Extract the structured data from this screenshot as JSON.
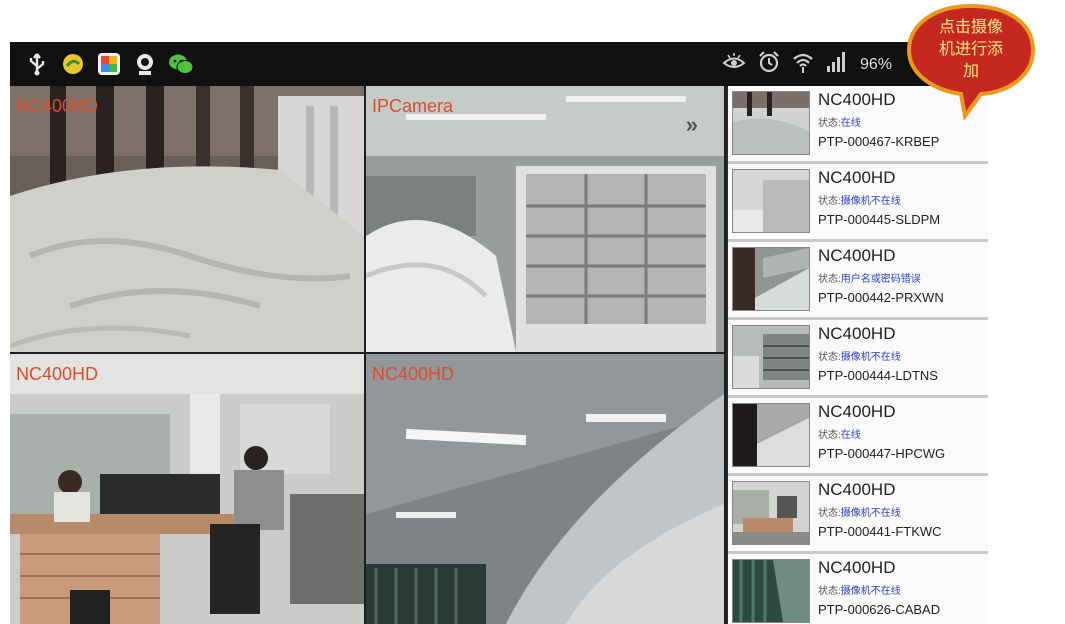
{
  "status_bar": {
    "battery_text": "96%",
    "left_icons": [
      "usb-icon",
      "bean-icon",
      "gallery-icon",
      "camera-app-icon",
      "wechat-icon"
    ],
    "right_icons": [
      "eye-icon",
      "alarm-clock-icon",
      "wifi-icon",
      "signal-icon"
    ]
  },
  "grid": {
    "tiles": [
      {
        "label": "NC400HD"
      },
      {
        "label": "IPCamera"
      },
      {
        "label": "NC400HD"
      },
      {
        "label": "NC400HD"
      }
    ]
  },
  "device_list": {
    "status_label": "状态:",
    "items": [
      {
        "name": "NC400HD",
        "status": "在线",
        "id": "PTP-000467-KRBEP"
      },
      {
        "name": "NC400HD",
        "status": "摄像机不在线",
        "id": "PTP-000445-SLDPM"
      },
      {
        "name": "NC400HD",
        "status": "用户名或密码错误",
        "id": "PTP-000442-PRXWN"
      },
      {
        "name": "NC400HD",
        "status": "摄像机不在线",
        "id": "PTP-000444-LDTNS"
      },
      {
        "name": "NC400HD",
        "status": "在线",
        "id": "PTP-000447-HPCWG"
      },
      {
        "name": "NC400HD",
        "status": "摄像机不在线",
        "id": "PTP-000441-FTKWC"
      },
      {
        "name": "NC400HD",
        "status": "摄像机不在线",
        "id": "PTP-000626-CABAD"
      }
    ]
  },
  "callout": {
    "line1": "点击摄像",
    "line2": "机进行添",
    "line3": "加"
  },
  "colors": {
    "label_orange": "#d6502e",
    "status_blue": "#2c3fd8",
    "callout_fill": "#c4281e",
    "callout_border": "#e99a1c"
  }
}
